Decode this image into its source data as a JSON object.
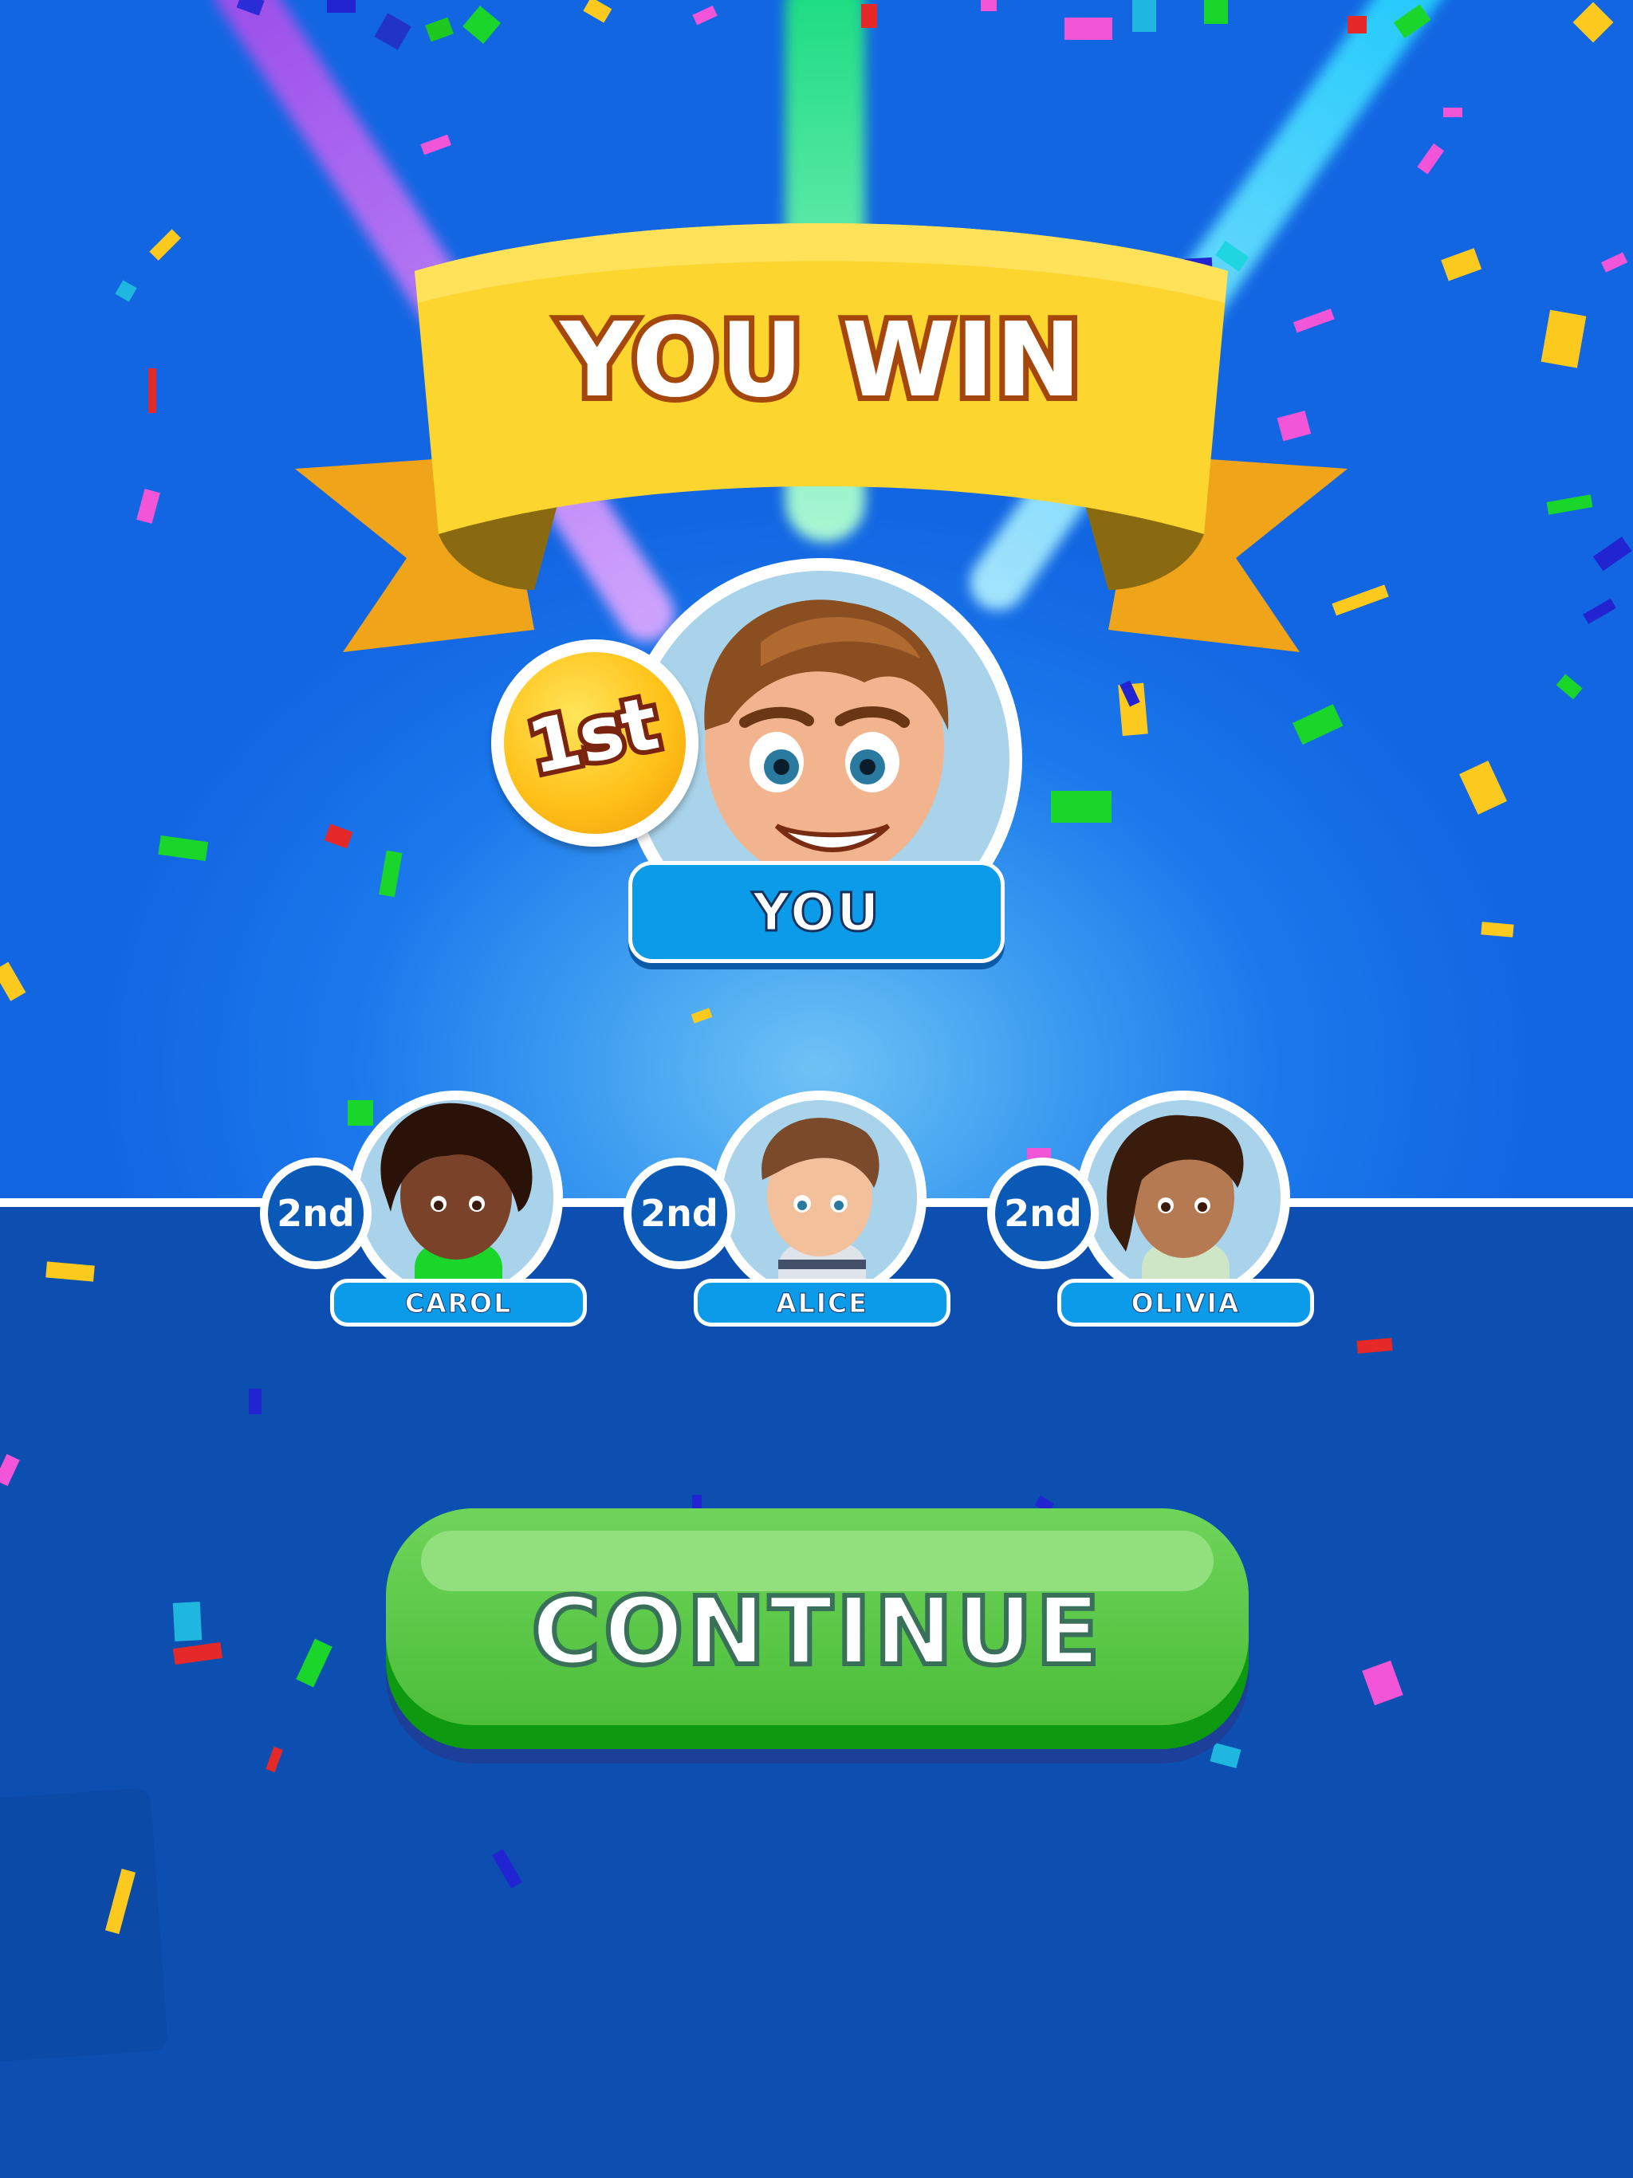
{
  "banner": {
    "title": "YOU WIN"
  },
  "winner": {
    "rank": "1st",
    "name": "YOU"
  },
  "players": [
    {
      "rank": "2nd",
      "name": "CAROL"
    },
    {
      "rank": "2nd",
      "name": "ALICE"
    },
    {
      "rank": "2nd",
      "name": "OLIVIA"
    }
  ],
  "continue_button": {
    "label": "CONTINUE"
  },
  "colors": {
    "background": "#1a78ec",
    "ribbon": "#fcd52f",
    "button_green": "#58c645",
    "name_plate": "#0c9be8",
    "rank_badge": "#0b59b6",
    "gold_medal": "#ffc21a"
  }
}
